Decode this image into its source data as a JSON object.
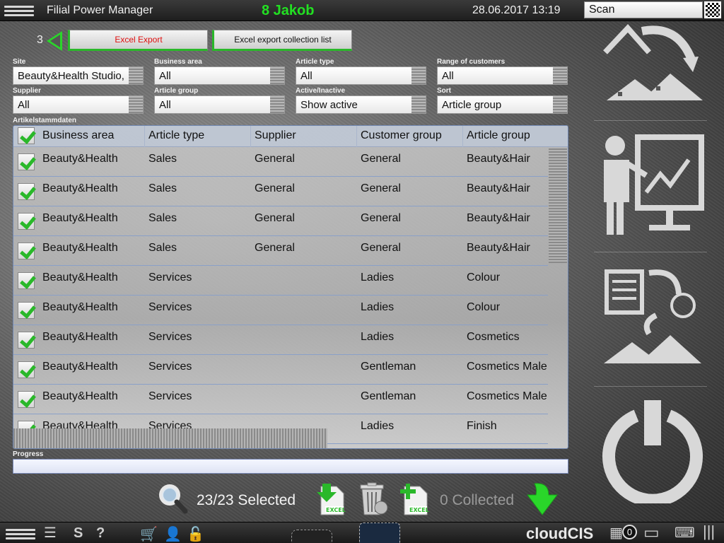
{
  "header": {
    "app_title": "Filial Power Manager",
    "user": "8 Jakob",
    "datetime": "28.06.2017 13:19",
    "scan_placeholder": "Scan"
  },
  "toolbar": {
    "count": "3",
    "excel_export": "Excel Export",
    "excel_collection": "Excel export collection list"
  },
  "filters": {
    "site": {
      "label": "Site",
      "value": "Beauty&Health Studio,"
    },
    "business_area": {
      "label": "Business area",
      "value": "All"
    },
    "article_type": {
      "label": "Article type",
      "value": "All"
    },
    "range_customers": {
      "label": "Range of customers",
      "value": "All"
    },
    "supplier": {
      "label": "Supplier",
      "value": "All"
    },
    "article_group": {
      "label": "Article group",
      "value": "All"
    },
    "active": {
      "label": "Active/Inactive",
      "value": "Show active"
    },
    "sort": {
      "label": "Sort",
      "value": "Article group"
    }
  },
  "table": {
    "title": "Artikelstammdaten",
    "columns": [
      "Business area",
      "Article type",
      "Supplier",
      "Customer group",
      "Article group"
    ],
    "rows": [
      [
        "Beauty&Health",
        "Sales",
        "General",
        "General",
        "Beauty&Hair"
      ],
      [
        "Beauty&Health",
        "Sales",
        "General",
        "General",
        "Beauty&Hair"
      ],
      [
        "Beauty&Health",
        "Sales",
        "General",
        "General",
        "Beauty&Hair"
      ],
      [
        "Beauty&Health",
        "Sales",
        "General",
        "General",
        "Beauty&Hair"
      ],
      [
        "Beauty&Health",
        "Services",
        "",
        "Ladies",
        "Colour"
      ],
      [
        "Beauty&Health",
        "Services",
        "",
        "Ladies",
        "Colour"
      ],
      [
        "Beauty&Health",
        "Services",
        "",
        "Ladies",
        "Cosmetics"
      ],
      [
        "Beauty&Health",
        "Services",
        "",
        "Gentleman",
        "Cosmetics Male"
      ],
      [
        "Beauty&Health",
        "Services",
        "",
        "Gentleman",
        "Cosmetics Male"
      ],
      [
        "Beauty&Health",
        "Services",
        "",
        "Ladies",
        "Finish"
      ]
    ]
  },
  "progress": {
    "label": "Progress",
    "value": 0
  },
  "actions": {
    "selected": "23/23 Selected",
    "collected": "0 Collected",
    "excel_badge": "EXCEL"
  },
  "statusbar": {
    "brand": "cloudCIS",
    "badge_count": "0",
    "s_label": "S",
    "help_label": "?"
  },
  "colors": {
    "accent_green": "#2ab82a",
    "user_green": "#22e022",
    "export_red": "#e01010"
  }
}
